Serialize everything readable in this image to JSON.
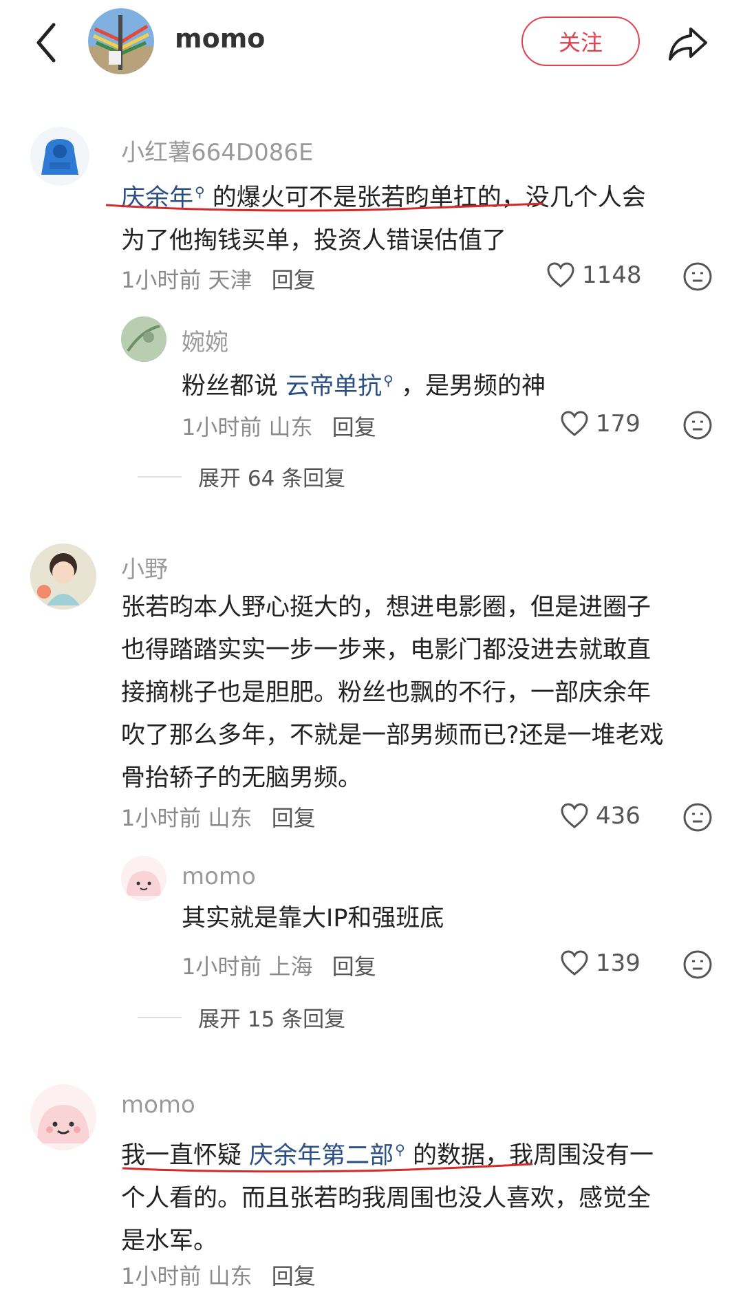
{
  "header": {
    "author_name": "momo",
    "follow_label": "关注"
  },
  "comments": [
    {
      "user": "小红薯664D086E",
      "text_tag": "庆余年",
      "text_rest_line1": " 的爆火可不是张若昀单扛的，没几个人会",
      "text_line2": "为了他掏钱买单，投资人错误估值了",
      "time": "1小时前",
      "location": "天津",
      "reply_label": "回复",
      "likes": "1148",
      "replies": [
        {
          "user": "婉婉",
          "text_pre": "粉丝都说 ",
          "text_tag": "云帝单抗",
          "text_post": " ，是男频的神",
          "time": "1小时前",
          "location": "山东",
          "reply_label": "回复",
          "likes": "179"
        }
      ],
      "expand_label": "展开 64 条回复"
    },
    {
      "user": "小野",
      "lines": [
        "张若昀本人野心挺大的，想进电影圈，但是进圈子",
        "也得踏踏实实一步一步来，电影门都没进去就敢直",
        "接摘桃子也是胆肥。粉丝也飘的不行，一部庆余年",
        "吹了那么多年，不就是一部男频而已?还是一堆老戏",
        "骨抬轿子的无脑男频。"
      ],
      "time": "1小时前",
      "location": "山东",
      "reply_label": "回复",
      "likes": "436",
      "replies": [
        {
          "user": "momo",
          "text": "其实就是靠大IP和强班底",
          "time": "1小时前",
          "location": "上海",
          "reply_label": "回复",
          "likes": "139"
        }
      ],
      "expand_label": "展开 15 条回复"
    },
    {
      "user": "momo",
      "text_pre": "我一直怀疑 ",
      "text_tag": "庆余年第二部",
      "text_post": " 的数据，我周围没有一",
      "lines": [
        "个人看的。而且张若昀我周围也没人喜欢，感觉全",
        "是水军。"
      ],
      "time": "1小时前",
      "location": "山东",
      "reply_label": "回复"
    }
  ]
}
